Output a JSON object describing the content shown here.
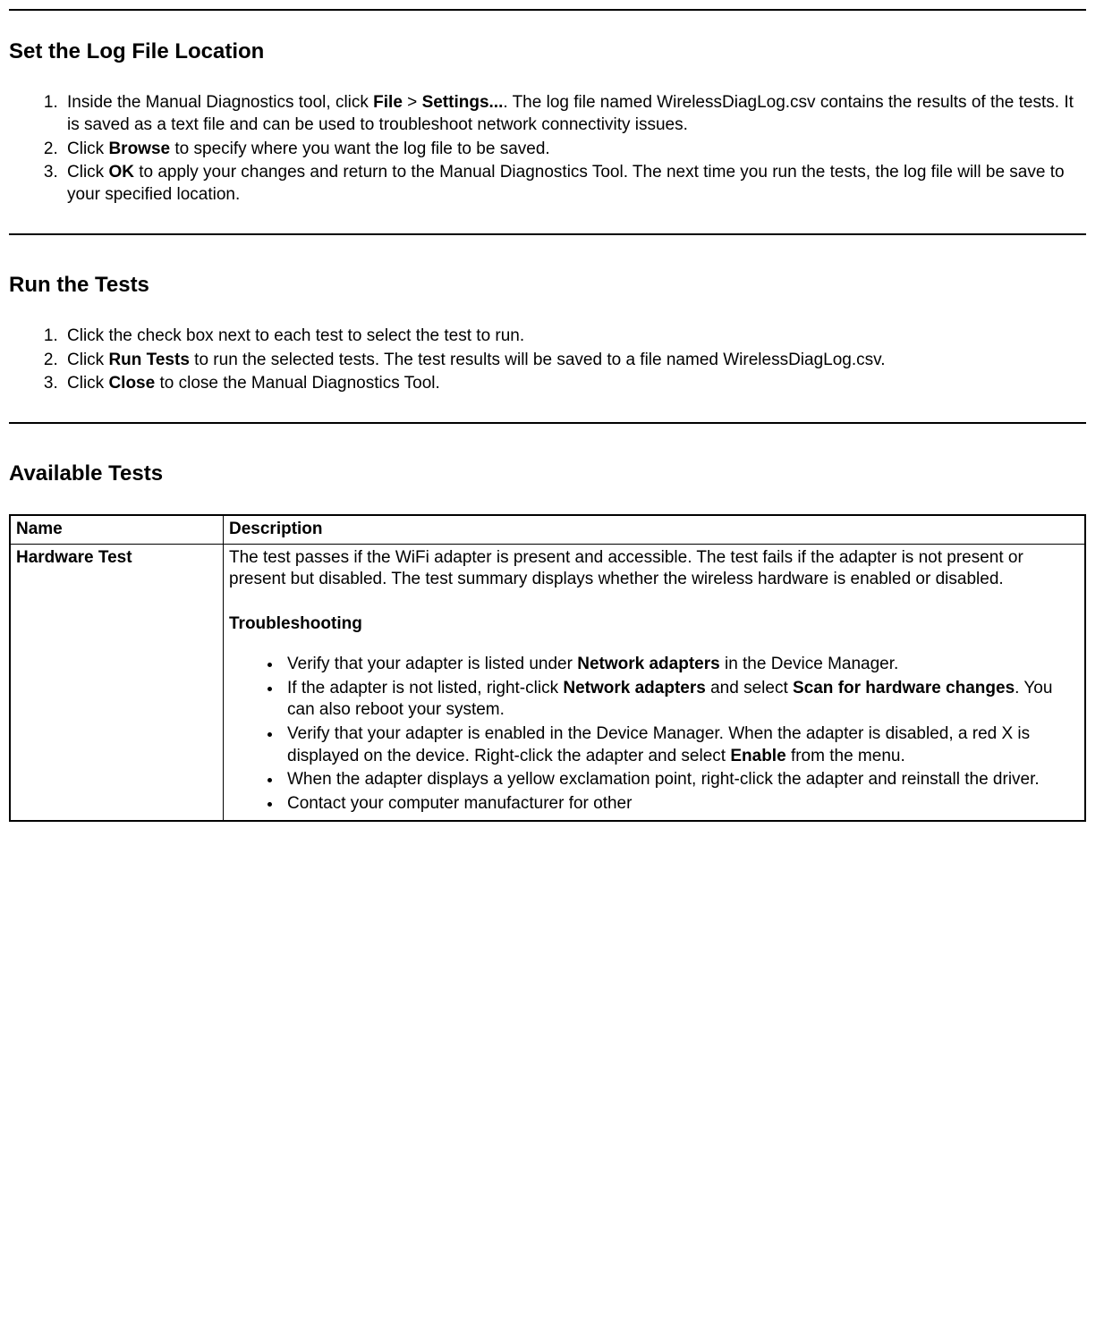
{
  "section1": {
    "heading": "Set the Log File Location",
    "step1_pre": "Inside the Manual Diagnostics tool, click ",
    "step1_b1": "File",
    "step1_mid1": " > ",
    "step1_b2": "Settings...",
    "step1_post": ". The log file named WirelessDiagLog.csv contains the results of the tests. It is saved as a text file and can be used to troubleshoot network connectivity issues.",
    "step2_pre": "Click ",
    "step2_b1": "Browse",
    "step2_post": " to specify where you want the log file to be saved.",
    "step3_pre": "Click ",
    "step3_b1": "OK",
    "step3_post": " to apply your changes and return to the Manual Diagnostics Tool. The next time you run the tests, the log file will be save to your specified location."
  },
  "section2": {
    "heading": "Run the Tests",
    "step1": "Click the check box next to each test to select the test to run.",
    "step2_pre": "Click ",
    "step2_b1": "Run Tests",
    "step2_post": " to run the selected tests. The test results will be saved to a file named WirelessDiagLog.csv.",
    "step3_pre": "Click ",
    "step3_b1": "Close",
    "step3_post": " to close the Manual Diagnostics Tool."
  },
  "section3": {
    "heading": "Available Tests",
    "col1": "Name",
    "col2": "Description",
    "row1_name": "Hardware Test",
    "row1_desc": "The test passes if the WiFi adapter is present and accessible. The test fails if the adapter is not present or present but disabled. The test summary displays whether the wireless hardware is enabled or disabled.",
    "row1_sub": "Troubleshooting",
    "row1_b1_pre": "Verify that your adapter is listed under ",
    "row1_b1_b": "Network adapters",
    "row1_b1_post": " in the Device Manager.",
    "row1_b2_pre": "If the adapter is not listed, right-click ",
    "row1_b2_b1": "Network adapters",
    "row1_b2_mid": " and select ",
    "row1_b2_b2": "Scan for hardware changes",
    "row1_b2_post": ". You can also reboot your system.",
    "row1_b3_pre": "Verify that your adapter is enabled in the Device Manager. When the adapter is disabled, a red X is displayed on the device. Right-click the adapter and select ",
    "row1_b3_b": "Enable",
    "row1_b3_post": " from the menu.",
    "row1_b4": "When the adapter displays a yellow exclamation point, right-click the adapter and reinstall the driver.",
    "row1_b5": "Contact your computer manufacturer for other"
  }
}
